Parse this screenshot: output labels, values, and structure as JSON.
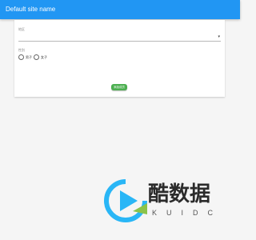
{
  "app_bar": {
    "title": "Default site name",
    "color": "#2196f3"
  },
  "form": {
    "region_field": {
      "label": "地区",
      "value": "",
      "dropdown_icon": "arrow-down-icon"
    },
    "gender_field": {
      "label": "性别",
      "options": [
        {
          "label": "男子",
          "selected": false
        },
        {
          "label": "女子",
          "selected": false
        }
      ]
    },
    "submit": {
      "label": "添加成员",
      "color": "#4caf50"
    }
  },
  "watermark": {
    "logo_icon": "kuidc-play-logo-icon",
    "text_cn": "酷数据",
    "text_en": "KUIDC",
    "colors": [
      "#29b6f6",
      "#8bc34a"
    ]
  }
}
